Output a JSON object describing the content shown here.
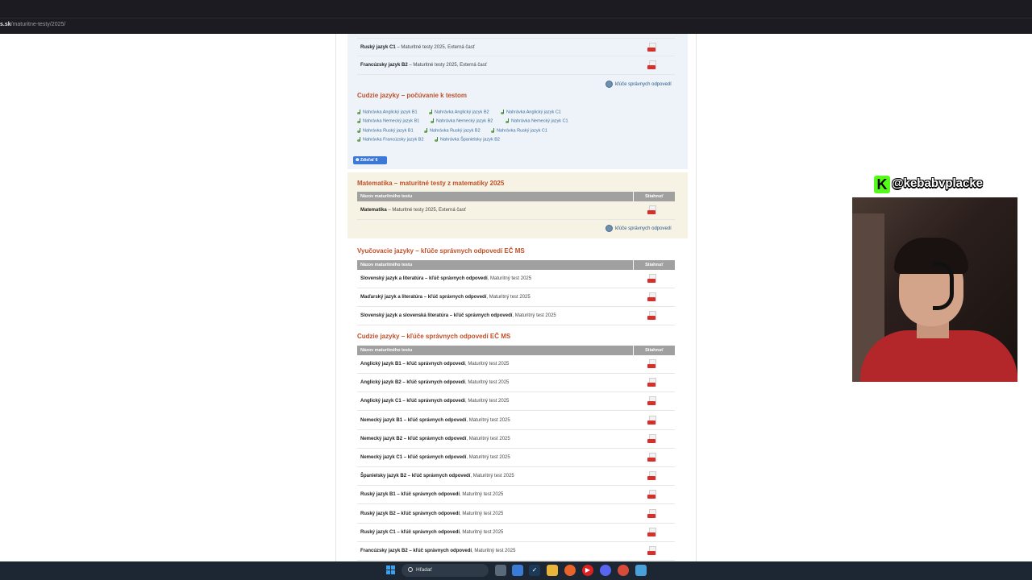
{
  "browser": {
    "url_domain": "s.sk",
    "url_path": "/maturitne-testy/2025/"
  },
  "foreign_tests": {
    "rows": [
      {
        "name": "Ruský jazyk C1",
        "desc": " – Maturitné testy 2025, Externá časť"
      },
      {
        "name": "Francúzsky jazyk B2",
        "desc": " – Maturitné testy 2025, Externá časť"
      }
    ],
    "keys_link": "kľúče správnych odpovedí"
  },
  "listening": {
    "title": "Cudzie jazyky – počúvanie k testom",
    "items": [
      "Nahrávka Anglický jazyk B1",
      "Nahrávka Anglický jazyk B2",
      "Nahrávka Anglický jazyk C1",
      "Nahrávka Nemecký jazyk B1",
      "Nahrávka Nemecký jazyk B2",
      "Nahrávka Nemecký jazyk C1",
      "Nahrávka Ruský jazyk B1",
      "Nahrávka Ruský jazyk B2",
      "Nahrávka Ruský jazyk C1",
      "Nahrávka Francúzsky jazyk B2",
      "Nahrávka Španielsky jazyk B2"
    ]
  },
  "share_button": "Zdieľať 6",
  "math": {
    "title": "Matematika – maturitné testy z matematiky 2025",
    "col_name": "Názov maturitného testu",
    "col_download": "Stiahnuť",
    "rows": [
      {
        "name": "Matematika",
        "desc": " – Maturitné testy 2025, Externá časť"
      }
    ],
    "keys_link": "kľúče správnych odpovedí"
  },
  "teaching_lang": {
    "title": "Vyučovacie jazyky – kľúče správnych odpovedí EČ MS",
    "col_name": "Názov maturitného testu",
    "col_download": "Stiahnuť",
    "rows": [
      {
        "name": "Slovenský jazyk a literatúra – kľúč správnych odpovedí",
        "desc": ", Maturitný test 2025"
      },
      {
        "name": "Maďarský jazyk a literatúra – kľúč správnych odpovedí",
        "desc": ", Maturitný test 2025"
      },
      {
        "name": "Slovenský jazyk a slovenská literatúra – kľúč správnych odpovedí",
        "desc": ", Maturitný test 2025"
      }
    ]
  },
  "foreign_keys": {
    "title": "Cudzie jazyky – kľúče správnych odpovedí EČ MS",
    "col_name": "Názov maturitného testu",
    "col_download": "Stiahnuť",
    "rows": [
      {
        "name": "Anglický jazyk B1 – kľúč správnych odpovedí",
        "desc": ", Maturitný test 2025"
      },
      {
        "name": "Anglický jazyk B2 – kľúč správnych odpovedí",
        "desc": ", Maturitný test 2025"
      },
      {
        "name": "Anglický jazyk C1 – kľúč správnych odpovedí",
        "desc": ", Maturitný test 2025"
      },
      {
        "name": "Nemecký jazyk B1 – kľúč správnych odpovedí",
        "desc": ", Maturitný test 2025"
      },
      {
        "name": "Nemecký jazyk B2 – kľúč správnych odpovedí",
        "desc": ", Maturitný test 2025"
      },
      {
        "name": "Nemecký jazyk C1 – kľúč správnych odpovedí",
        "desc": ", Maturitný test 2025"
      },
      {
        "name": "Španielsky jazyk B2 – kľúč správnych odpovedí",
        "desc": ", Maturitný test 2025"
      },
      {
        "name": "Ruský jazyk B1 – kľúč správnych odpovedí",
        "desc": ", Maturitný test 2025"
      },
      {
        "name": "Ruský jazyk B2 – kľúč správnych odpovedí",
        "desc": ", Maturitný test 2025"
      },
      {
        "name": "Ruský jazyk C1 – kľúč správnych odpovedí",
        "desc": ", Maturitný test 2025"
      },
      {
        "name": "Francúzsky jazyk B2 – kľúč správnych odpovedí",
        "desc": ", Maturitný test 2025"
      }
    ]
  },
  "overlay": {
    "handle": "@kebabvplacke",
    "logo_letter": "K",
    "logo_color": "#53fc18"
  },
  "taskbar": {
    "search_label": "Hľadať",
    "icons": [
      "windows-icon",
      "file-icon",
      "store-icon",
      "steam-icon",
      "folder-icon",
      "firefox-icon",
      "youtube-icon",
      "discord-icon",
      "chrome-icon",
      "notepad-icon"
    ]
  },
  "colors": {
    "section_title": "#c0502a",
    "table_header": "#a0a0a0",
    "pdf_red": "#d7302a",
    "taskbar_bg": "#1d2733"
  }
}
